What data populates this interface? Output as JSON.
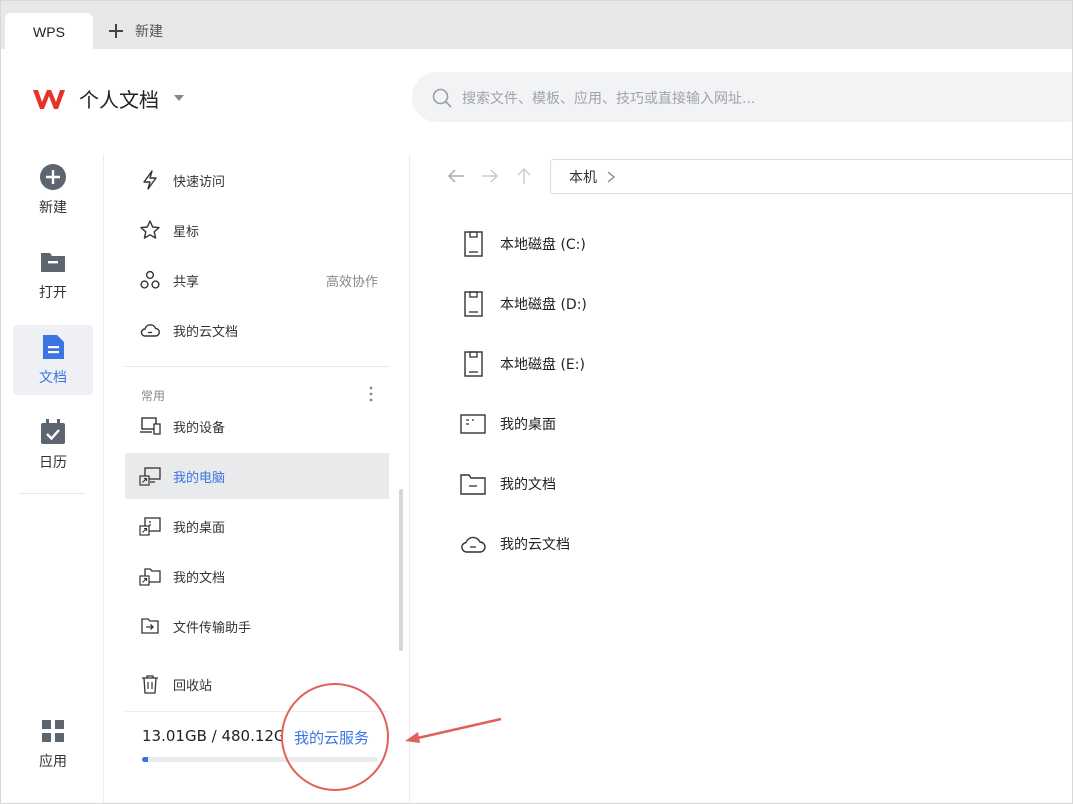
{
  "tabs": {
    "active": "WPS",
    "new_label": "新建"
  },
  "header": {
    "title": "个人文档",
    "search_placeholder": "搜索文件、模板、应用、技巧或直接输入网址..."
  },
  "rail": [
    {
      "label": "新建",
      "icon": "plus-circle-icon"
    },
    {
      "label": "打开",
      "icon": "folder-icon"
    },
    {
      "label": "文档",
      "icon": "document-icon",
      "active": true
    },
    {
      "label": "日历",
      "icon": "calendar-check-icon"
    },
    {
      "label": "应用",
      "icon": "apps-grid-icon"
    }
  ],
  "sidebar": {
    "top_items": [
      {
        "label": "快速访问",
        "icon": "lightning-icon"
      },
      {
        "label": "星标",
        "icon": "star-icon"
      },
      {
        "label": "共享",
        "icon": "share-icon",
        "right": "高效协作"
      },
      {
        "label": "我的云文档",
        "icon": "cloud-icon"
      }
    ],
    "section_title": "常用",
    "common_items": [
      {
        "label": "我的设备",
        "icon": "device-icon"
      },
      {
        "label": "我的电脑",
        "icon": "computer-shortcut-icon",
        "active": true
      },
      {
        "label": "我的桌面",
        "icon": "desktop-shortcut-icon"
      },
      {
        "label": "我的文档",
        "icon": "folder-shortcut-icon"
      },
      {
        "label": "文件传输助手",
        "icon": "transfer-icon"
      }
    ],
    "recycle": "回收站",
    "storage": {
      "text": "13.01GB / 480.12GB",
      "link": "我的云服务",
      "used_fraction": 0.027
    }
  },
  "main": {
    "path": "本机",
    "items": [
      {
        "label": "本地磁盘 (C:)",
        "icon": "disk-icon"
      },
      {
        "label": "本地磁盘 (D:)",
        "icon": "disk-icon"
      },
      {
        "label": "本地磁盘 (E:)",
        "icon": "disk-icon"
      },
      {
        "label": "我的桌面",
        "icon": "desktop-icon"
      },
      {
        "label": "我的文档",
        "icon": "folder-icon"
      },
      {
        "label": "我的云文档",
        "icon": "cloud-icon"
      }
    ]
  },
  "colors": {
    "accent": "#3b74e3",
    "annotation": "#e0605a"
  }
}
